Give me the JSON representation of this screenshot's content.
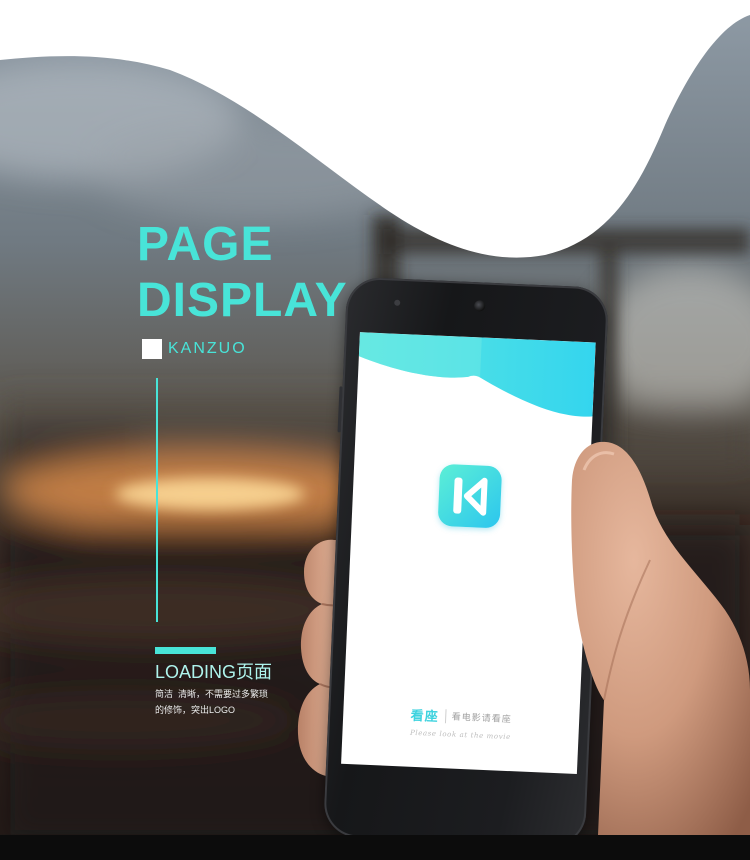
{
  "poster": {
    "title_line1": "PAGE",
    "title_line2": "DISPLAY",
    "brand": "KANZUO",
    "section_title": "LOADING页面",
    "description": [
      "简洁  清晰，不需要过多繁琐",
      "的修饰，突出LOGO"
    ]
  },
  "app_screen": {
    "logo_icon": "kanzuo-k-logo-icon",
    "app_name": "看座",
    "slogan": "看电影请看座",
    "tagline": "Please look at the movie"
  },
  "colors": {
    "accent": "#48e4d8",
    "section_title": "#aef3ec",
    "screen_cloud_start": "#5ce6e1",
    "screen_cloud_end": "#34d5ee",
    "phone_body": "#1b1c1e",
    "bottom_bar": "#0c0c0c"
  }
}
